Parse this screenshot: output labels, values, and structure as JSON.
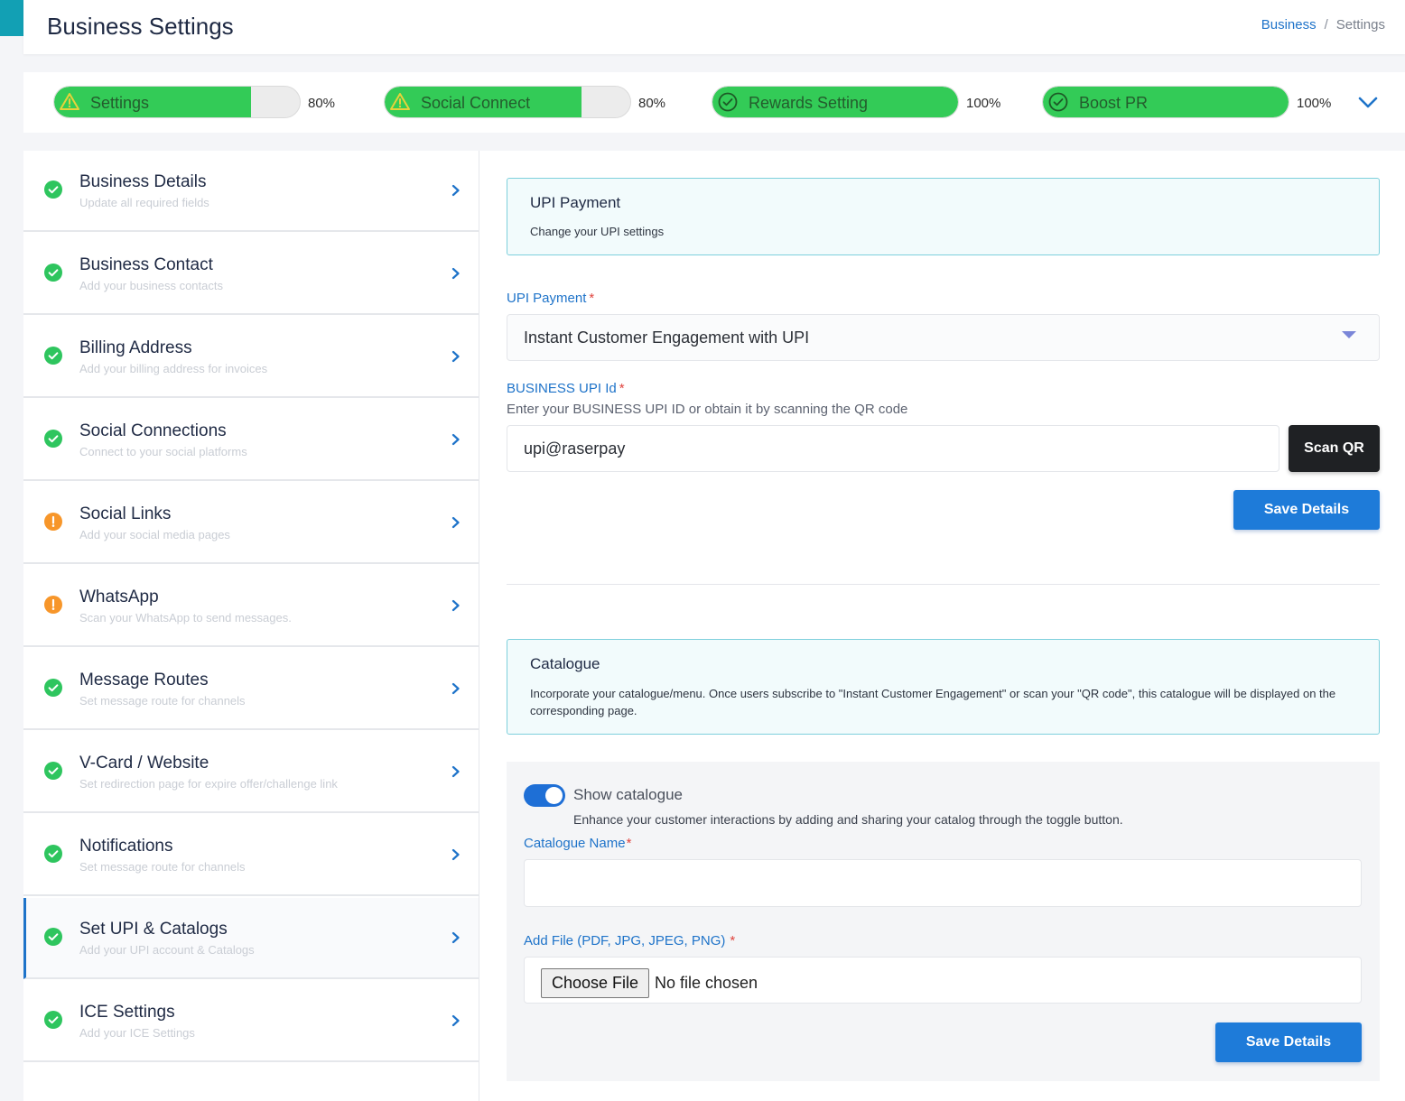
{
  "header": {
    "title": "Business Settings",
    "breadcrumb": {
      "parent": "Business",
      "separator": "/",
      "current": "Settings"
    }
  },
  "progress": [
    {
      "label": "Settings",
      "percent_text": "80%",
      "value": 80,
      "icon": "warning-icon"
    },
    {
      "label": "Social Connect",
      "percent_text": "80%",
      "value": 80,
      "icon": "warning-icon"
    },
    {
      "label": "Rewards Setting",
      "percent_text": "100%",
      "value": 100,
      "icon": "check-circle-icon"
    },
    {
      "label": "Boost PR",
      "percent_text": "100%",
      "value": 100,
      "icon": "check-circle-icon"
    }
  ],
  "sidebar": {
    "items": [
      {
        "title": "Business Details",
        "subtitle": "Update all required fields",
        "status": "complete"
      },
      {
        "title": "Business Contact",
        "subtitle": "Add your business contacts",
        "status": "complete"
      },
      {
        "title": "Billing Address",
        "subtitle": "Add your billing address for invoices",
        "status": "complete"
      },
      {
        "title": "Social Connections",
        "subtitle": "Connect to your social platforms",
        "status": "complete"
      },
      {
        "title": "Social Links",
        "subtitle": "Add your social media pages",
        "status": "warning"
      },
      {
        "title": "WhatsApp",
        "subtitle": "Scan your WhatsApp to send messages.",
        "status": "warning"
      },
      {
        "title": "Message Routes",
        "subtitle": "Set message route for channels",
        "status": "complete"
      },
      {
        "title": "V-Card / Website",
        "subtitle": "Set redirection page for expire offer/challenge link",
        "status": "complete"
      },
      {
        "title": "Notifications",
        "subtitle": "Set message route for channels",
        "status": "complete"
      },
      {
        "title": "Set UPI & Catalogs",
        "subtitle": "Add your UPI account & Catalogs",
        "status": "complete",
        "active": true
      },
      {
        "title": "ICE Settings",
        "subtitle": "Add your ICE Settings",
        "status": "complete"
      }
    ]
  },
  "upi_section": {
    "title": "UPI Payment",
    "description": "Change your UPI settings",
    "payment_label": "UPI Payment",
    "required_mark": "*",
    "payment_value": "Instant Customer Engagement with UPI",
    "upi_id_label": "BUSINESS UPI Id",
    "upi_id_help": "Enter your BUSINESS UPI ID or obtain it by scanning the QR code",
    "upi_id_value": "upi@raserpay",
    "scan_button": "Scan QR",
    "save_button": "Save Details"
  },
  "catalogue_section": {
    "title": "Catalogue",
    "description": "Incorporate your catalogue/menu. Once users subscribe to \"Instant Customer Engagement\" or scan your \"QR code\", this catalogue will be displayed on the corresponding page.",
    "toggle_label": "Show catalogue",
    "toggle_on": true,
    "toggle_help": "Enhance your customer interactions by adding and sharing your catalog through the toggle button.",
    "name_label": "Catalogue Name",
    "required_mark": "*",
    "name_value": "",
    "file_label": "Add File (PDF, JPG, JPEG, PNG)",
    "file_button": "Choose File",
    "file_status": "No file chosen",
    "save_button": "Save Details"
  },
  "colors": {
    "accent": "#1e73c9",
    "progress_fill": "#33cb57",
    "complete": "#2ec55e",
    "warning": "#f7962a",
    "info_bg": "#f2fbfc",
    "info_border": "#7ed0dc"
  }
}
